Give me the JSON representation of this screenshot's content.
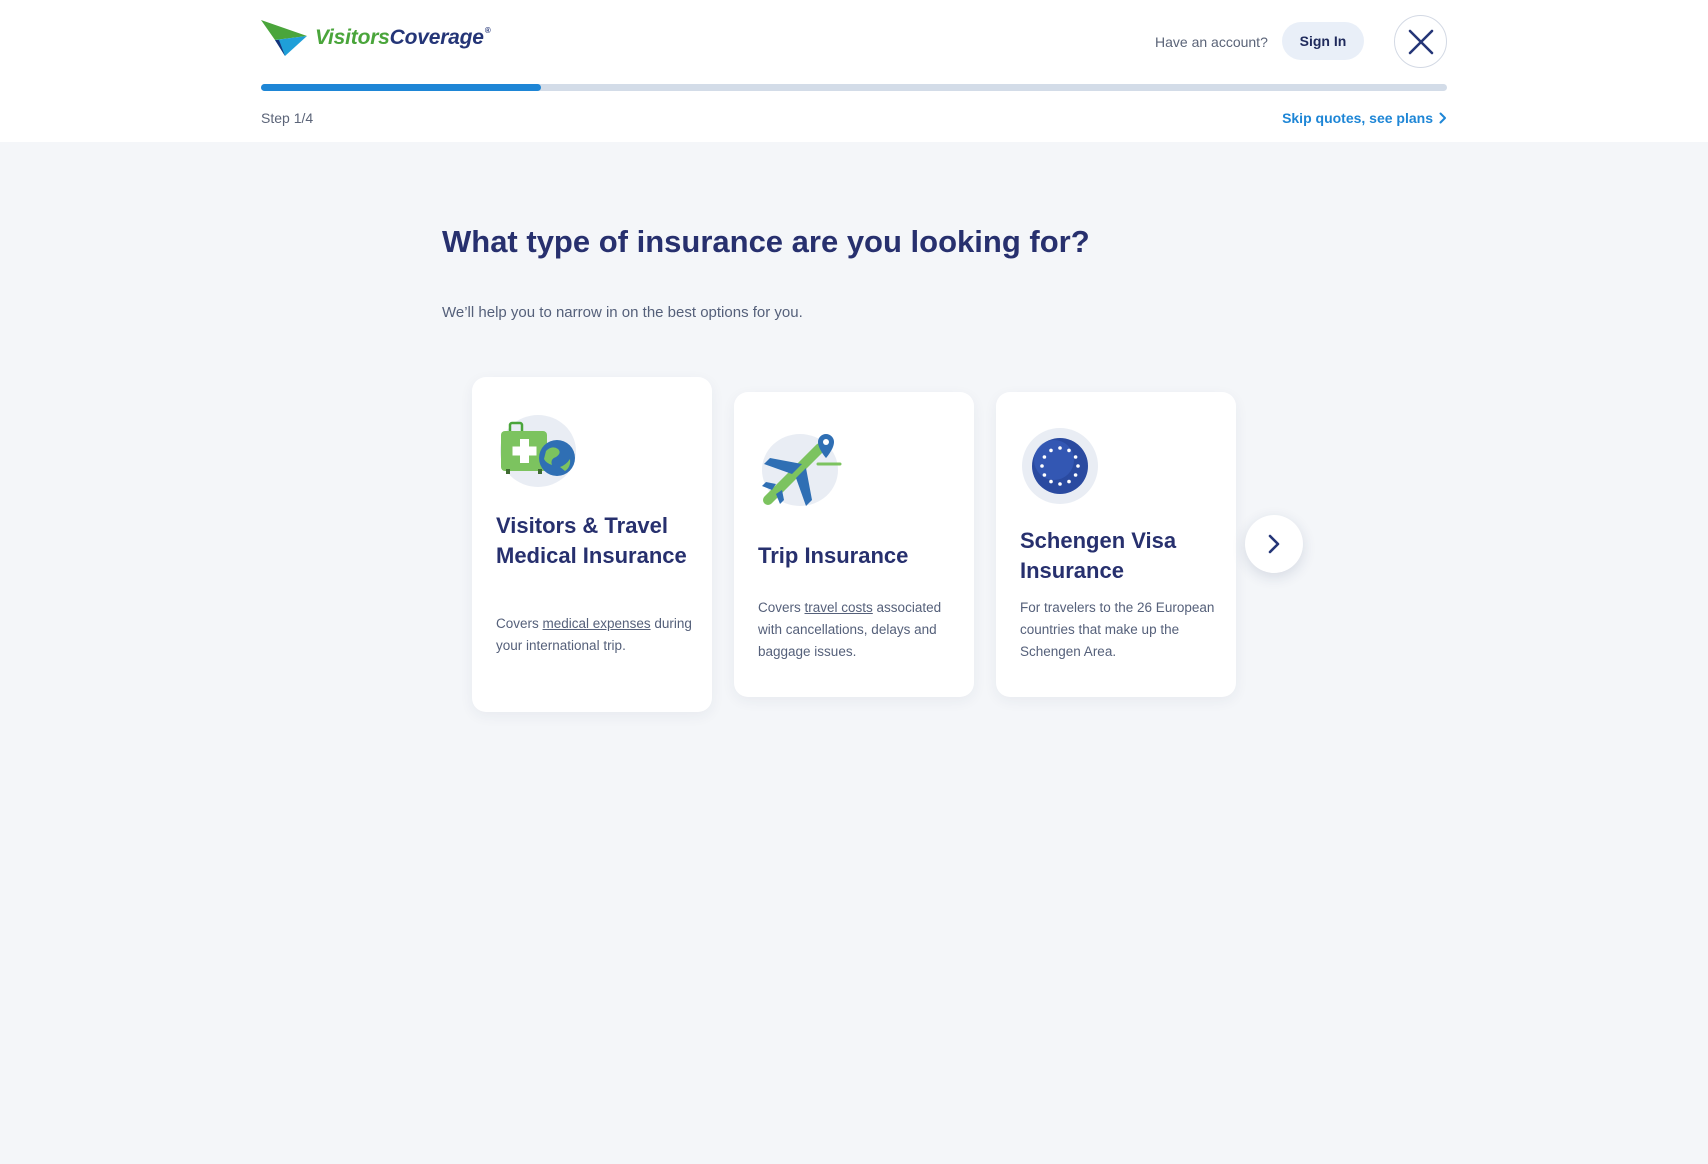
{
  "header": {
    "brand": {
      "part1": "Visitors",
      "part2": "Coverage",
      "reg": "®"
    },
    "account_prompt": "Have an account?",
    "signin_label": "Sign In"
  },
  "progress": {
    "step_label": "Step 1/4",
    "fraction": 0.2365
  },
  "skip_label": "Skip quotes, see plans",
  "main": {
    "title": "What type of insurance are you looking for?",
    "subtitle": "We’ll help you to narrow in on the best options for you."
  },
  "cards": [
    {
      "icon": "medical-luggage-globe-icon",
      "title": "Visitors & Travel Medical Insurance",
      "desc_prefix": "Covers ",
      "desc_link": "medical expenses",
      "desc_suffix": " during your international trip."
    },
    {
      "icon": "plane-location-icon",
      "title": "Trip Insurance",
      "desc_prefix": "Covers ",
      "desc_link": "travel costs",
      "desc_suffix": " associated with cancellations, delays and baggage issues."
    },
    {
      "icon": "eu-stars-globe-icon",
      "title": "Schengen Visa Insurance",
      "desc": "For travelers to the 26 European countries that make up the Schengen Area."
    }
  ],
  "colors": {
    "brand_green": "#4aa53b",
    "brand_navy": "#243577",
    "accent_blue": "#1e86d6",
    "page_bg": "#f4f6f9"
  }
}
